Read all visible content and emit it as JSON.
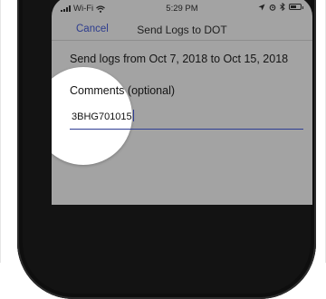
{
  "status_bar": {
    "carrier": "Wi-Fi",
    "time": "5:29 PM"
  },
  "nav": {
    "cancel_label": "Cancel",
    "title": "Send Logs to DOT"
  },
  "form": {
    "date_range_text": "Send logs from Oct 7, 2018 to Oct 15, 2018",
    "comments_label": "Comments (optional)",
    "comments_value": "3BHG701015"
  },
  "battery_level": 0.55,
  "colors": {
    "accent": "#2f3e94",
    "screen_bg": "#a3a3a3"
  },
  "icons": [
    "signal-bars-icon",
    "wifi-icon",
    "location-arrow-icon",
    "alarm-icon",
    "bluetooth-icon",
    "battery-icon"
  ]
}
